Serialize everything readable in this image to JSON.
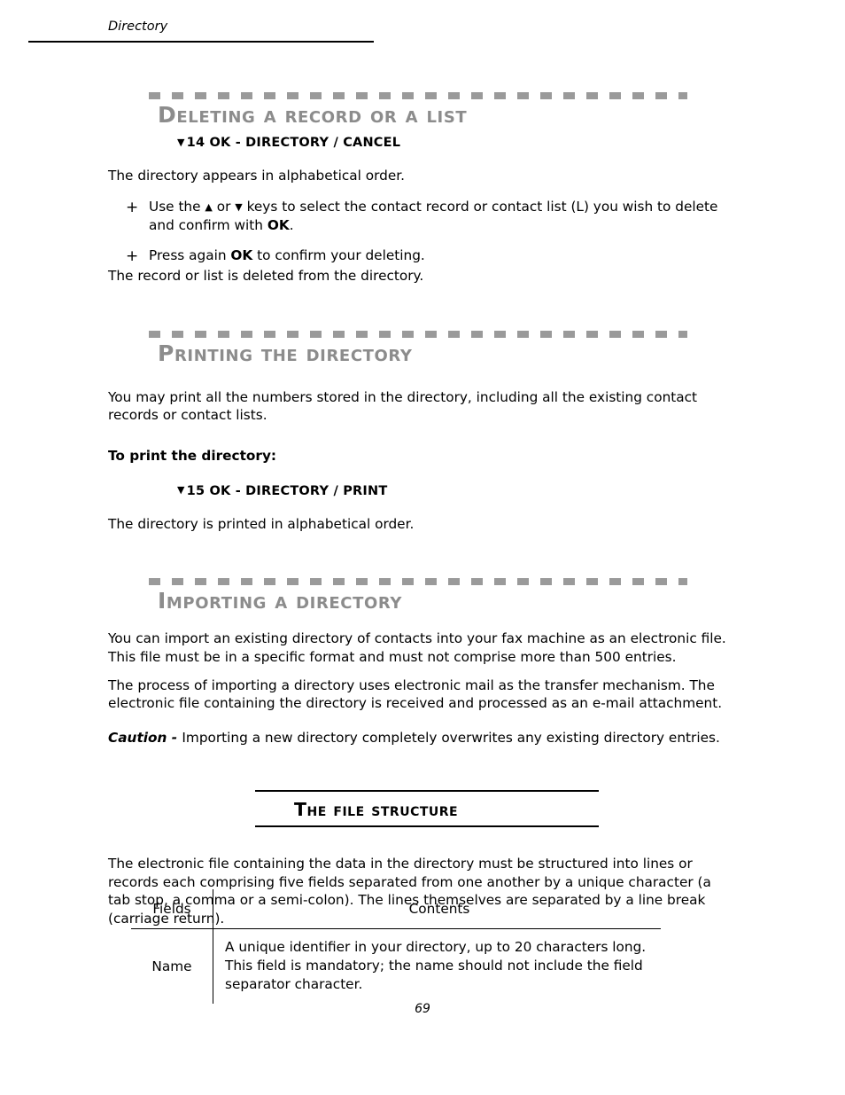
{
  "page": {
    "running_header": "Directory",
    "page_number": "69",
    "rule_color": "#000000",
    "dash_rule_color": "#9a9a9a",
    "section_title_color": "#8c8c8c"
  },
  "sections": [
    {
      "title": "Deleting a record or a list",
      "menu_path": "14 OK - DIRECTORY / CANCEL",
      "menu_path_marker": "▼",
      "intro": "The directory appears in alphabetical order.",
      "bullets": [
        {
          "marker": "+",
          "prefix": "Use the ",
          "up_arrow": "▲",
          "mid": " or ",
          "down_arrow": "▼",
          "suffix": "  keys to select the contact record or contact list (L) you wish to delete and confirm with ",
          "bold_tail": "OK",
          "end": "."
        },
        {
          "marker": "+",
          "prefix": "Press again ",
          "bold_tail": "OK",
          "suffix": " to confirm your deleting."
        }
      ],
      "closing": "The  record or list is deleted from the directory."
    },
    {
      "title": "Printing the directory",
      "paragraph": "You may print all the numbers stored in the directory, including all the existing contact records or contact lists.",
      "lead_in": "To print the directory:",
      "menu_path": "15 OK - DIRECTORY / PRINT",
      "menu_path_marker": "▼",
      "closing": "The directory is printed in alphabetical order."
    },
    {
      "title": "Importing a directory",
      "paragraph_1": "You can import an existing directory of contacts into your fax machine as an electronic file. This file must be in a specific format and must not comprise more than 500 entries.",
      "paragraph_2": "The process of importing a directory uses electronic mail as the transfer mechanism. The electronic file containing the directory is received and processed as an e-mail attachment.",
      "caution_label": "Caution - ",
      "caution_text": "Importing a new directory completely overwrites any existing directory entries."
    }
  ],
  "subsection": {
    "title": "The file structure",
    "paragraph": "The electronic file containing the data in the directory must be structured into lines or records each comprising five fields separated from one another by a unique character (a tab stop, a comma or a semi-colon). The lines themselves are separated by a line break (carriage return)."
  },
  "table": {
    "headers": [
      "Fields",
      "Contents"
    ],
    "rows": [
      {
        "field": "Name",
        "contents": "A unique identifier in your directory, up to 20 characters long. This field is mandatory; the name should not include the field separator character."
      }
    ]
  }
}
